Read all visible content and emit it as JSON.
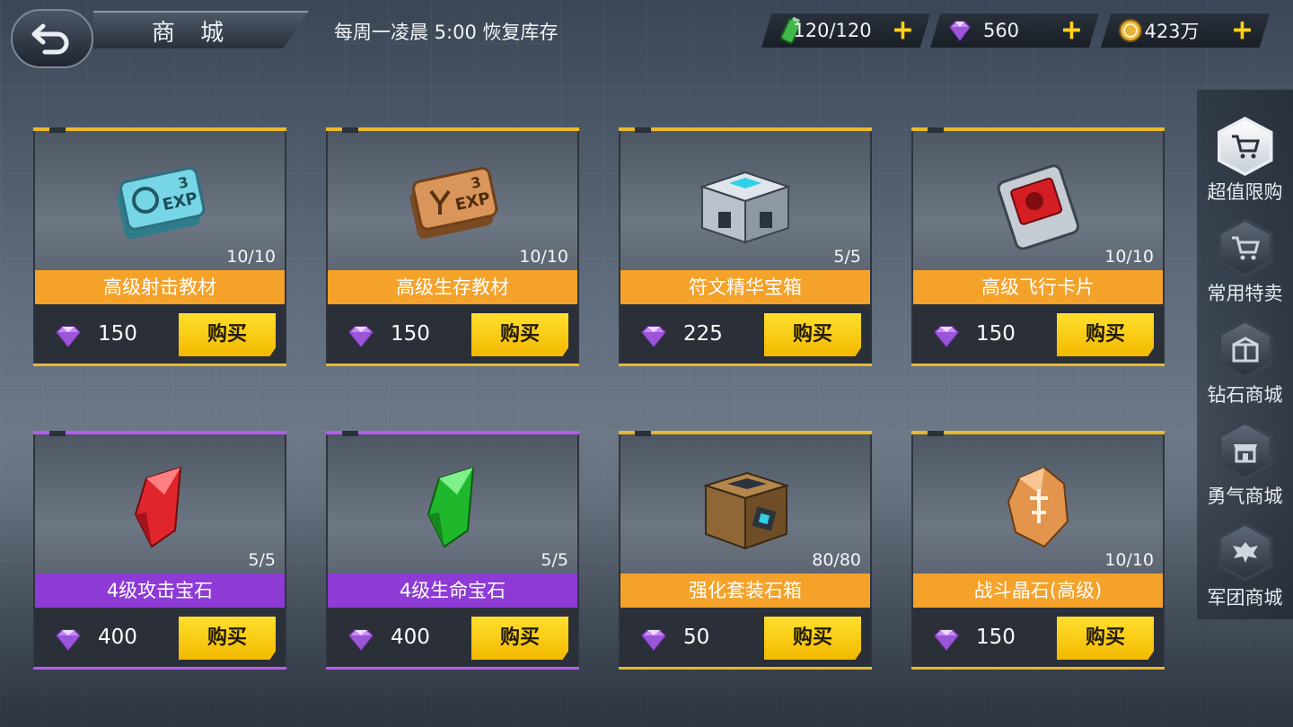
{
  "header": {
    "title": "商 城",
    "restock_note": "每周一凌晨 5:00 恢复库存"
  },
  "resources": {
    "stamina": "120/120",
    "diamonds": "560",
    "coins": "423万"
  },
  "sidebar": {
    "items": [
      {
        "label": "超值限购",
        "active": true
      },
      {
        "label": "常用特卖",
        "active": false
      },
      {
        "label": "钻石商城",
        "active": false
      },
      {
        "label": "勇气商城",
        "active": false
      },
      {
        "label": "军团商城",
        "active": false
      }
    ]
  },
  "shop": {
    "buy_label": "购买",
    "items": [
      {
        "name": "高级射击教材",
        "stock": "10/10",
        "price": "150",
        "tier": "orange",
        "icon": "exp-card-blue"
      },
      {
        "name": "高级生存教材",
        "stock": "10/10",
        "price": "150",
        "tier": "orange",
        "icon": "exp-card-bronze"
      },
      {
        "name": "符文精华宝箱",
        "stock": "5/5",
        "price": "225",
        "tier": "orange",
        "icon": "rune-chest"
      },
      {
        "name": "高级飞行卡片",
        "stock": "10/10",
        "price": "150",
        "tier": "orange",
        "icon": "flight-card"
      },
      {
        "name": "4级攻击宝石",
        "stock": "5/5",
        "price": "400",
        "tier": "purple",
        "icon": "red-gem"
      },
      {
        "name": "4级生命宝石",
        "stock": "5/5",
        "price": "400",
        "tier": "purple",
        "icon": "green-gem"
      },
      {
        "name": "强化套装石箱",
        "stock": "80/80",
        "price": "50",
        "tier": "orange",
        "icon": "stone-crate"
      },
      {
        "name": "战斗晶石(高级)",
        "stock": "10/10",
        "price": "150",
        "tier": "orange",
        "icon": "battle-crystal"
      }
    ]
  },
  "colors": {
    "orange_banner": "#f4a22a",
    "purple_banner": "#8e3bd6",
    "buy_button": "#ffd21c"
  }
}
